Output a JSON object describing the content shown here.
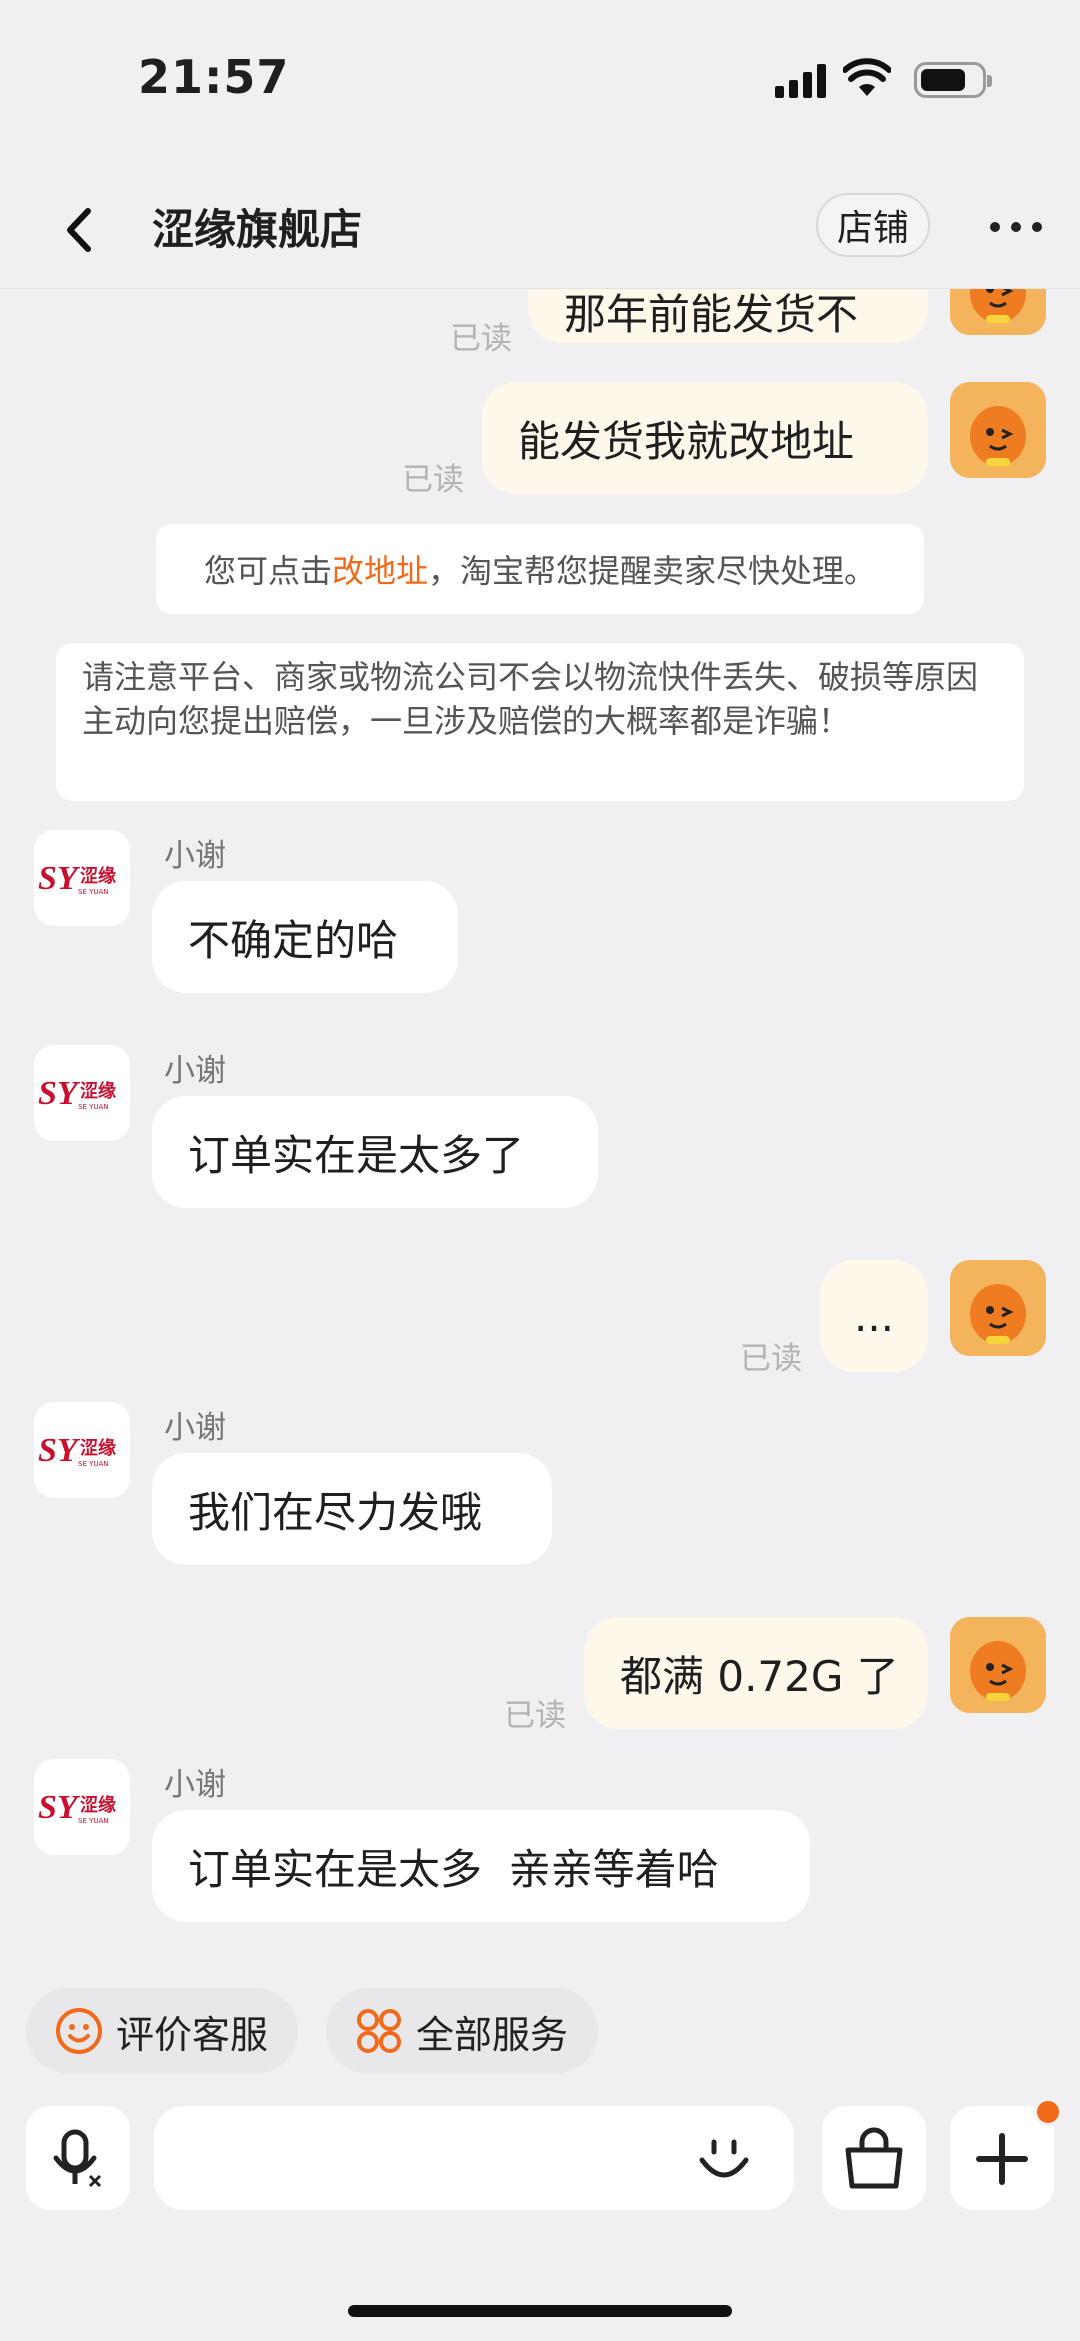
{
  "status_bar": {
    "time": "21:57"
  },
  "header": {
    "title": "涩缘旗舰店",
    "shop_button": "店铺"
  },
  "messages": {
    "m1": {
      "text": "那年前能发货不",
      "read": "已读"
    },
    "m2": {
      "text": "能发货我就改地址",
      "read": "已读"
    },
    "tip": {
      "prefix": "您可点击",
      "link": "改地址",
      "suffix": "，淘宝帮您提醒卖家尽快处理。"
    },
    "warning": "请注意平台、商家或物流公司不会以物流快件丢失、破损等原因主动向您提出赔偿，一旦涉及赔偿的大概率都是诈骗！",
    "s1": {
      "sender": "小谢",
      "text": "不确定的哈"
    },
    "s2": {
      "sender": "小谢",
      "text": "订单实在是太多了"
    },
    "m3": {
      "text": "...",
      "read": "已读"
    },
    "s3": {
      "sender": "小谢",
      "text": "我们在尽力发哦"
    },
    "m4": {
      "text": "都满 0.72G 了",
      "read": "已读"
    },
    "s4": {
      "sender": "小谢",
      "text": "订单实在是太多  亲亲等着哈"
    }
  },
  "shop_logo": {
    "mark": "SY",
    "name": "涩缘",
    "sub": "SE YUAN"
  },
  "services": {
    "rate": "评价客服",
    "all": "全部服务"
  },
  "colors": {
    "accent": "#f06a1a",
    "my_bubble": "#fdf8ea",
    "background": "#f0eff1"
  },
  "icons": [
    "back-icon",
    "more-icon",
    "smile-icon",
    "grid-icon",
    "voice-icon",
    "emoji-icon",
    "bag-icon",
    "plus-icon"
  ]
}
